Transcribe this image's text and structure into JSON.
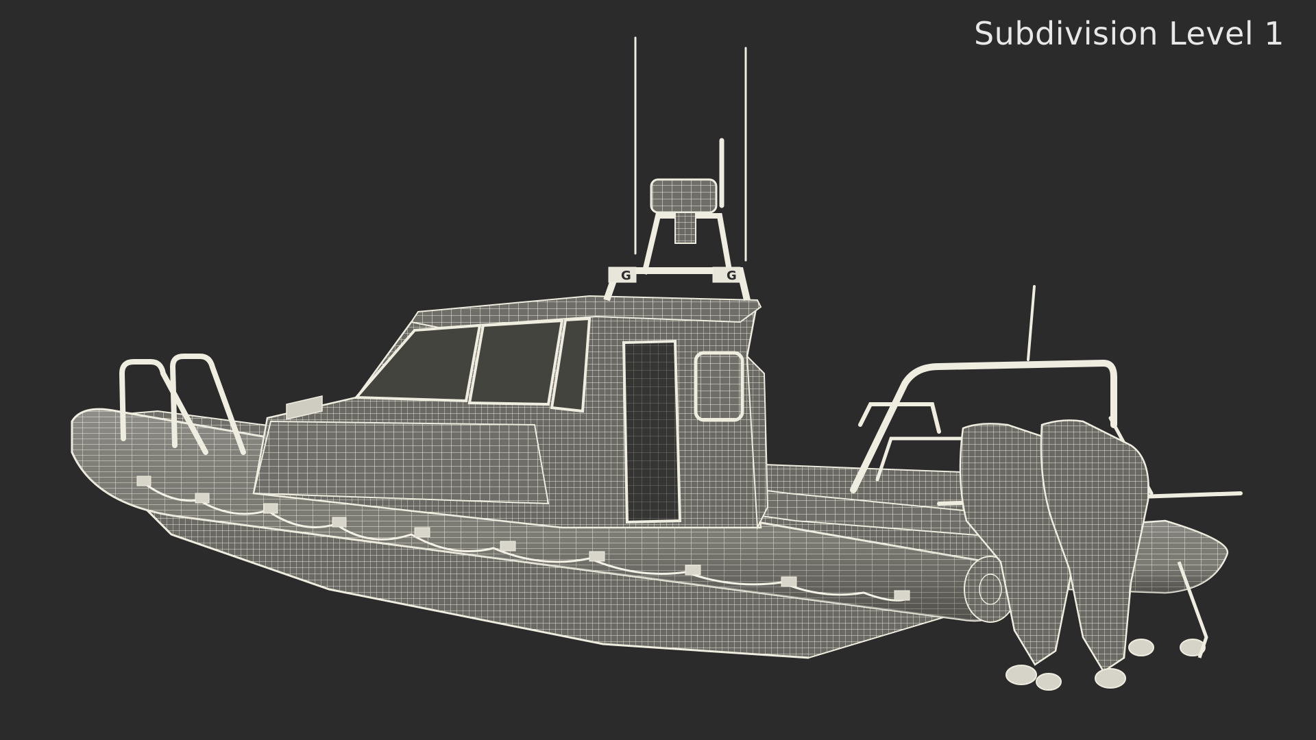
{
  "viewport": {
    "subdivision_label": "Subdivision Level 1",
    "background_color": "#2b2b2b"
  },
  "model": {
    "subject": "rigid inflatable patrol boat wireframe",
    "wire_color": "#efede0",
    "shade_color": "#8f8d84",
    "logo_mark": "G"
  }
}
